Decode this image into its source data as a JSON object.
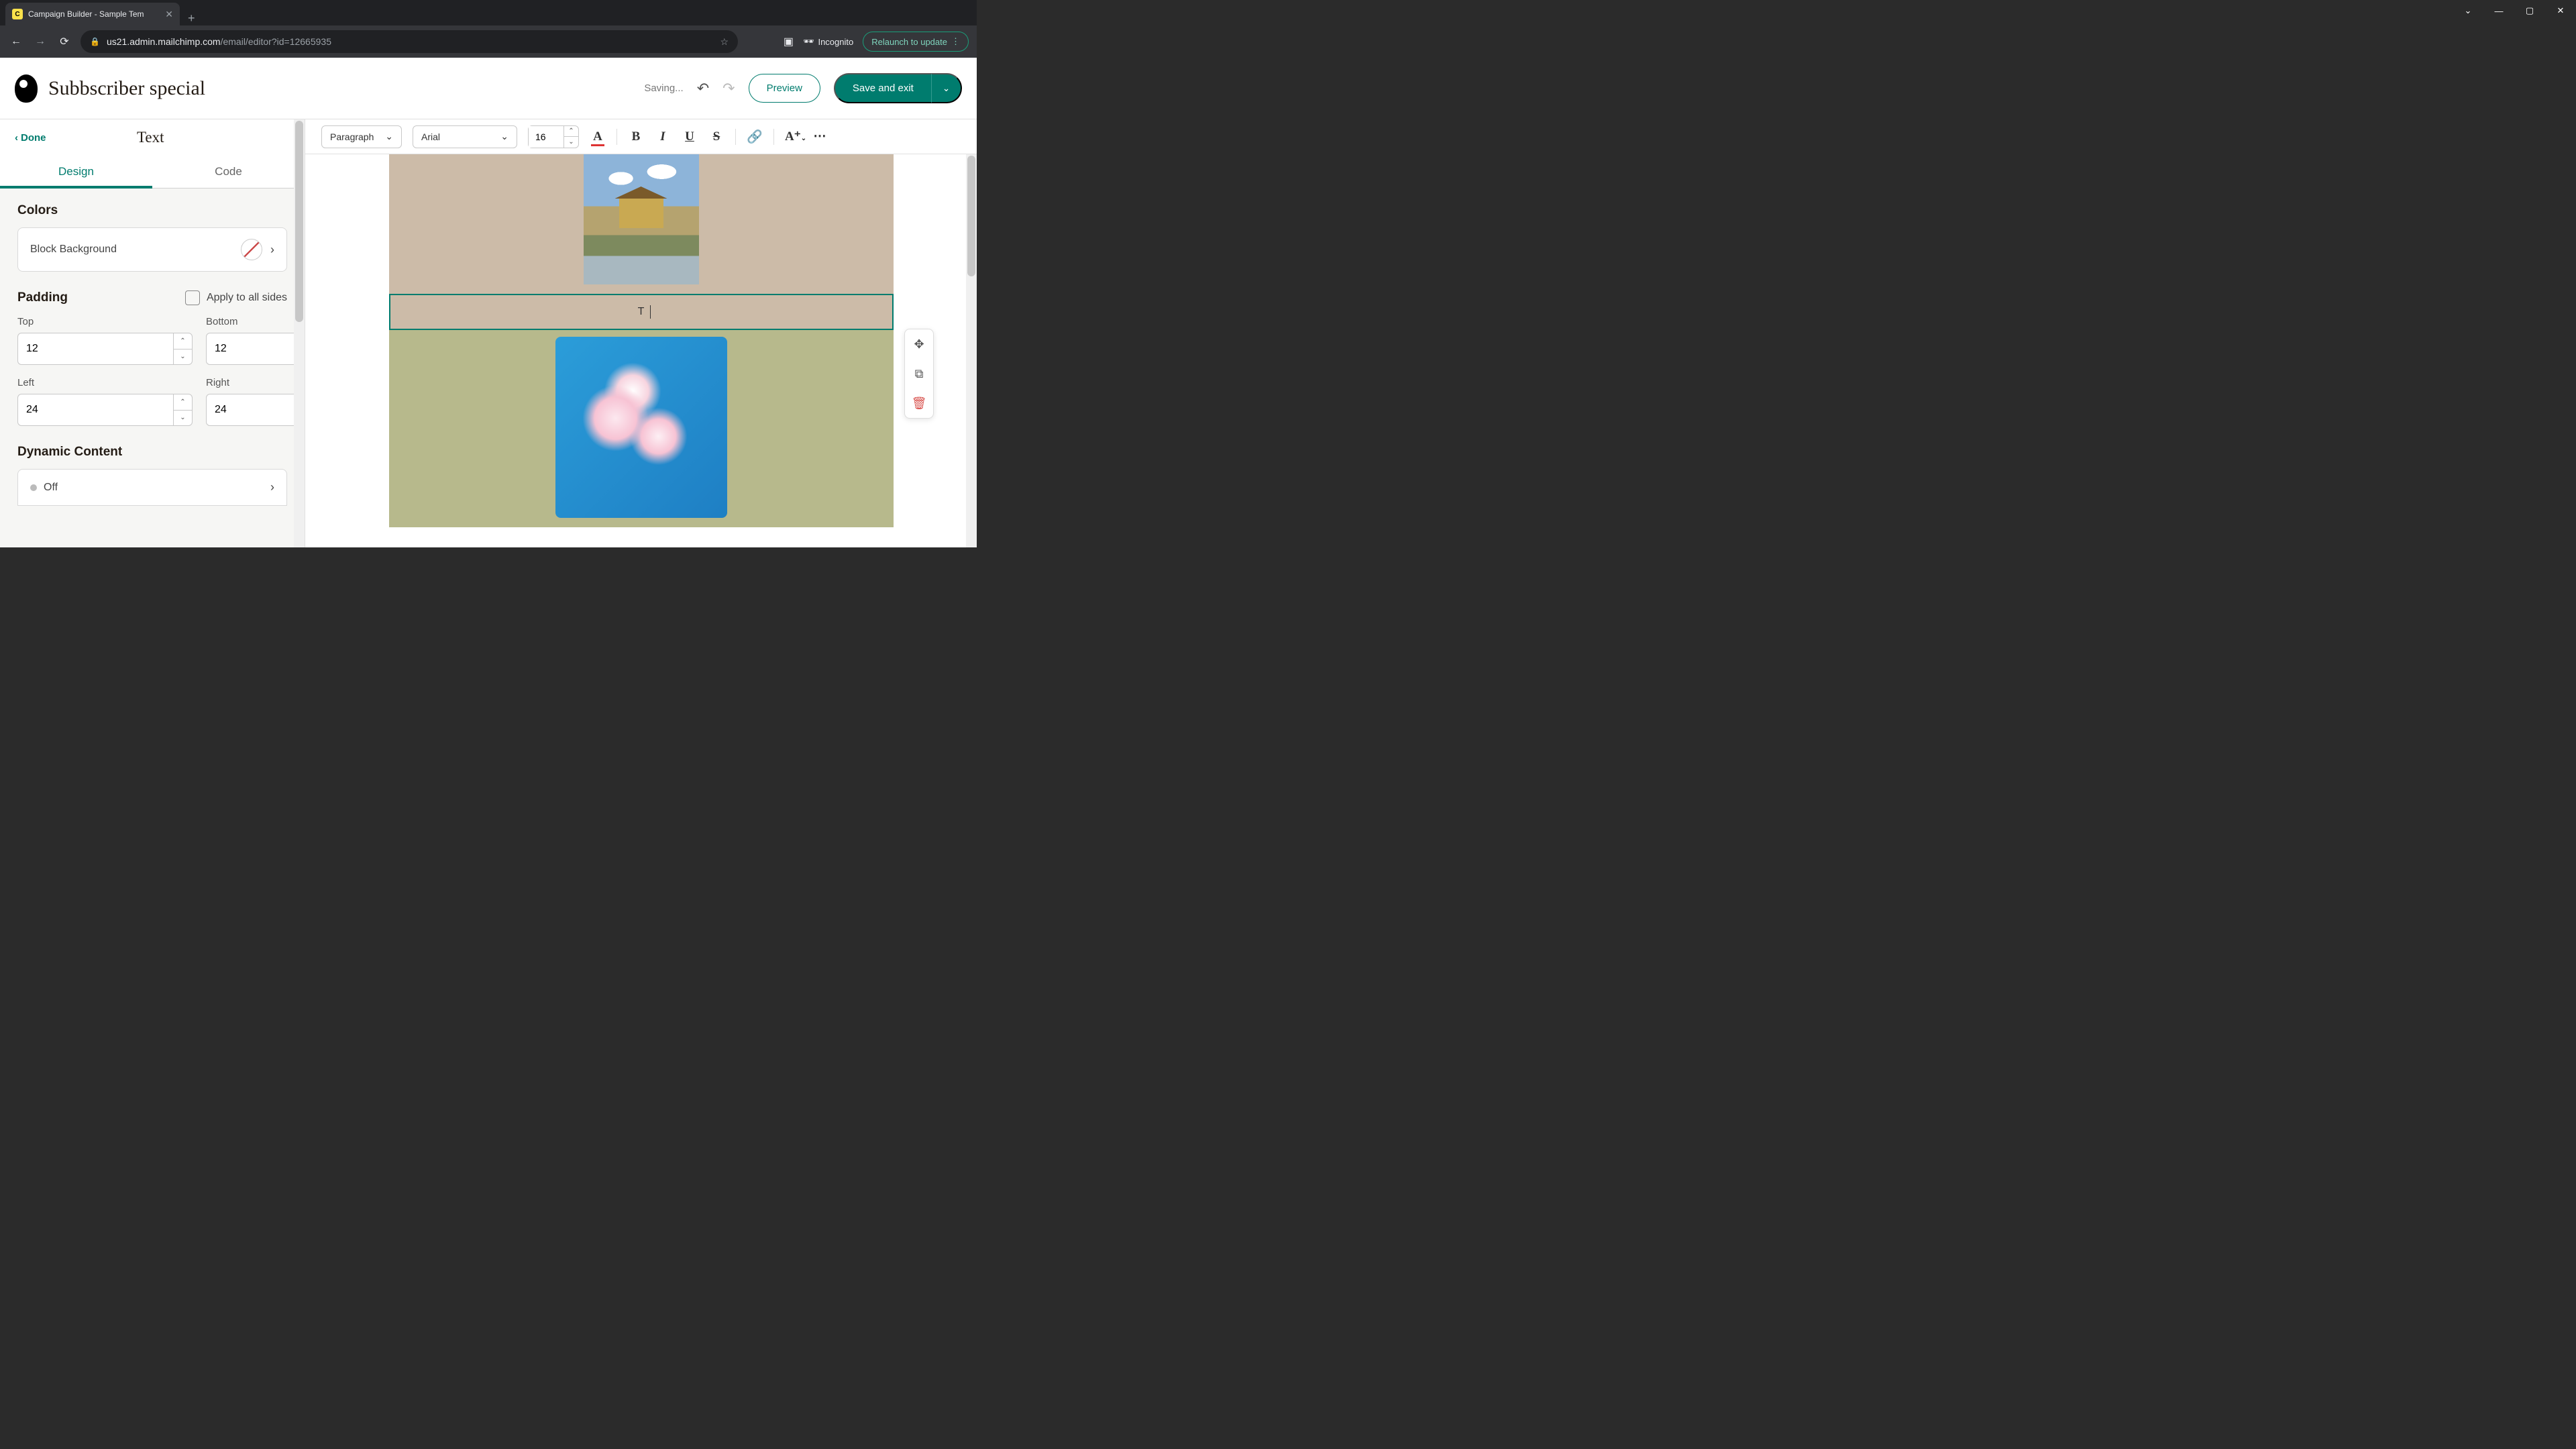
{
  "browser": {
    "tab_title": "Campaign Builder - Sample Tem",
    "url_host": "us21.admin.mailchimp.com",
    "url_path": "/email/editor?id=12665935",
    "incognito": "Incognito",
    "relaunch": "Relaunch to update"
  },
  "header": {
    "project_title": "Subbscriber special",
    "status": "Saving...",
    "preview": "Preview",
    "save_exit": "Save and exit"
  },
  "sidebar": {
    "done": "Done",
    "title": "Text",
    "tabs": {
      "design": "Design",
      "code": "Code"
    },
    "colors": {
      "heading": "Colors",
      "block_bg": "Block Background"
    },
    "padding": {
      "heading": "Padding",
      "apply_all": "Apply to all sides",
      "top_label": "Top",
      "top_value": "12",
      "bottom_label": "Bottom",
      "bottom_value": "12",
      "left_label": "Left",
      "left_value": "24",
      "right_label": "Right",
      "right_value": "24"
    },
    "dynamic": {
      "heading": "Dynamic Content",
      "off": "Off"
    }
  },
  "toolbar": {
    "para": "Paragraph",
    "font": "Arial",
    "size": "16"
  },
  "canvas": {
    "text_content": "T"
  }
}
